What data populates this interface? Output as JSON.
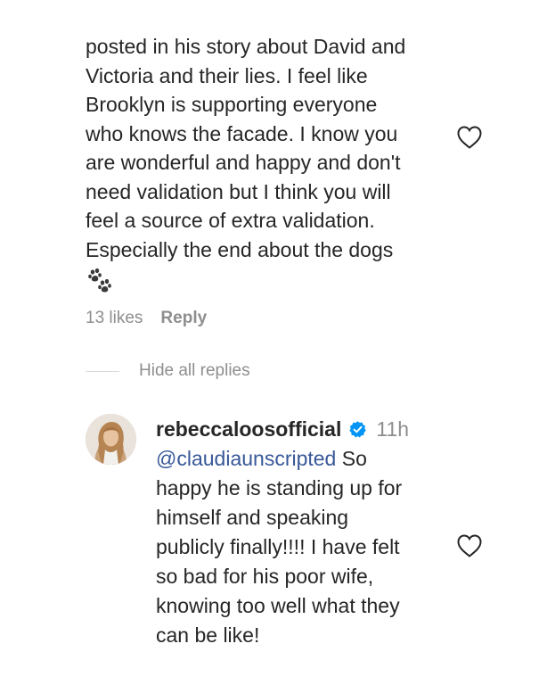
{
  "comment": {
    "lines": [
      "posted in his story about David and",
      "Victoria and their lies. I feel like",
      "Brooklyn is supporting everyone",
      "who knows the facade. I know you",
      "are wonderful and happy and don't",
      "need validation but I think you will",
      "feel a source of extra validation.",
      "Especially the end about the dogs"
    ],
    "emoji_icon": "paw-prints-icon",
    "likes": "13 likes",
    "reply_label": "Reply",
    "like_icon": "heart-outline-icon"
  },
  "replies_toggle": {
    "label": "Hide all replies"
  },
  "reply": {
    "username": "rebeccaloosofficial",
    "verified_icon": "verified-badge-icon",
    "verified_color": "#0095f6",
    "timestamp": "11h",
    "mention": "@claudiaunscripted",
    "lines": [
      " So",
      "happy he is standing up for",
      "himself and speaking",
      "publicly finally!!!! I have felt",
      "so bad for his poor wife,",
      "knowing too well what they",
      "can be like!"
    ],
    "like_icon": "heart-outline-icon"
  },
  "colors": {
    "text": "#262626",
    "secondary": "#8e8e8e",
    "link": "#385898",
    "divider": "#dbdbdb"
  }
}
